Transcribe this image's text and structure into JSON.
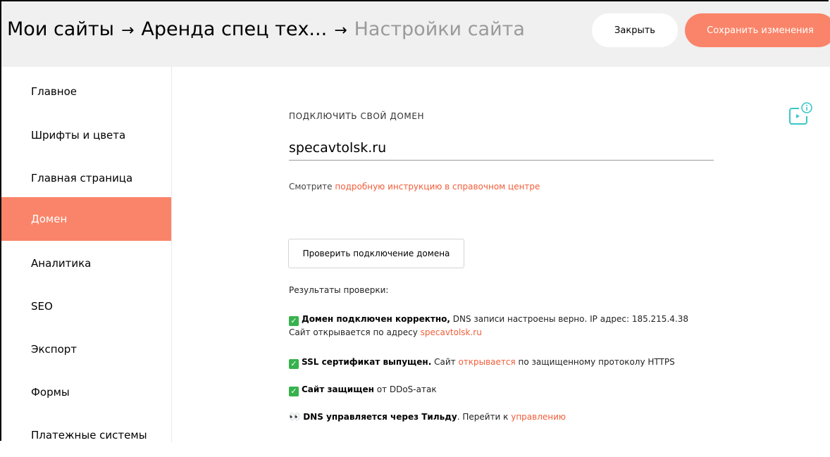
{
  "header": {
    "breadcrumb": [
      "Мои сайты",
      "Аренда спец тех...",
      "Настройки сайта"
    ],
    "arrow": "→",
    "close_label": "Закрыть",
    "save_label": "Сохранить изменения"
  },
  "sidebar": {
    "items": [
      {
        "label": "Главное"
      },
      {
        "label": "Шрифты и цвета"
      },
      {
        "label": "Главная страница"
      },
      {
        "label": "Домен",
        "active": true
      },
      {
        "label": "Аналитика"
      },
      {
        "label": "SEO"
      },
      {
        "label": "Экспорт"
      },
      {
        "label": "Формы"
      },
      {
        "label": "Платежные системы"
      }
    ]
  },
  "domain": {
    "label": "ПОДКЛЮЧИТЬ СВОЙ ДОМЕН",
    "value": "specavtolsk.ru",
    "help_prefix": "Смотрите ",
    "help_link": "подробную инструкцию в справочном центре"
  },
  "check_button_label": "Проверить подключение домена",
  "results": {
    "label": "Результаты проверки:",
    "domain_ok_bold": "Домен подключен корректно,",
    "domain_ok_text": " DNS записи настроены верно. IP адрес: 185.215.4.38",
    "opens_prefix": "Сайт открывается по адресу ",
    "opens_link": "specavtolsk.ru",
    "ssl_bold": "SSL сертификат выпущен.",
    "ssl_text1": " Сайт ",
    "ssl_link": "открывается",
    "ssl_text2": " по защищенному протоколу HTTPS",
    "ddos_bold": "Сайт защищен",
    "ddos_text": " от DDoS-атак",
    "dns_bold": "DNS управляется через Тильду",
    "dns_text": ". Перейти к ",
    "dns_link": "управлению"
  },
  "colors": {
    "accent": "#fa8469",
    "link": "#f15d39",
    "check": "#37b24d",
    "icon": "#3cc6c6"
  },
  "icons": {
    "info": "video-info-icon",
    "check": "check-icon",
    "eyes": "eyes-icon"
  }
}
